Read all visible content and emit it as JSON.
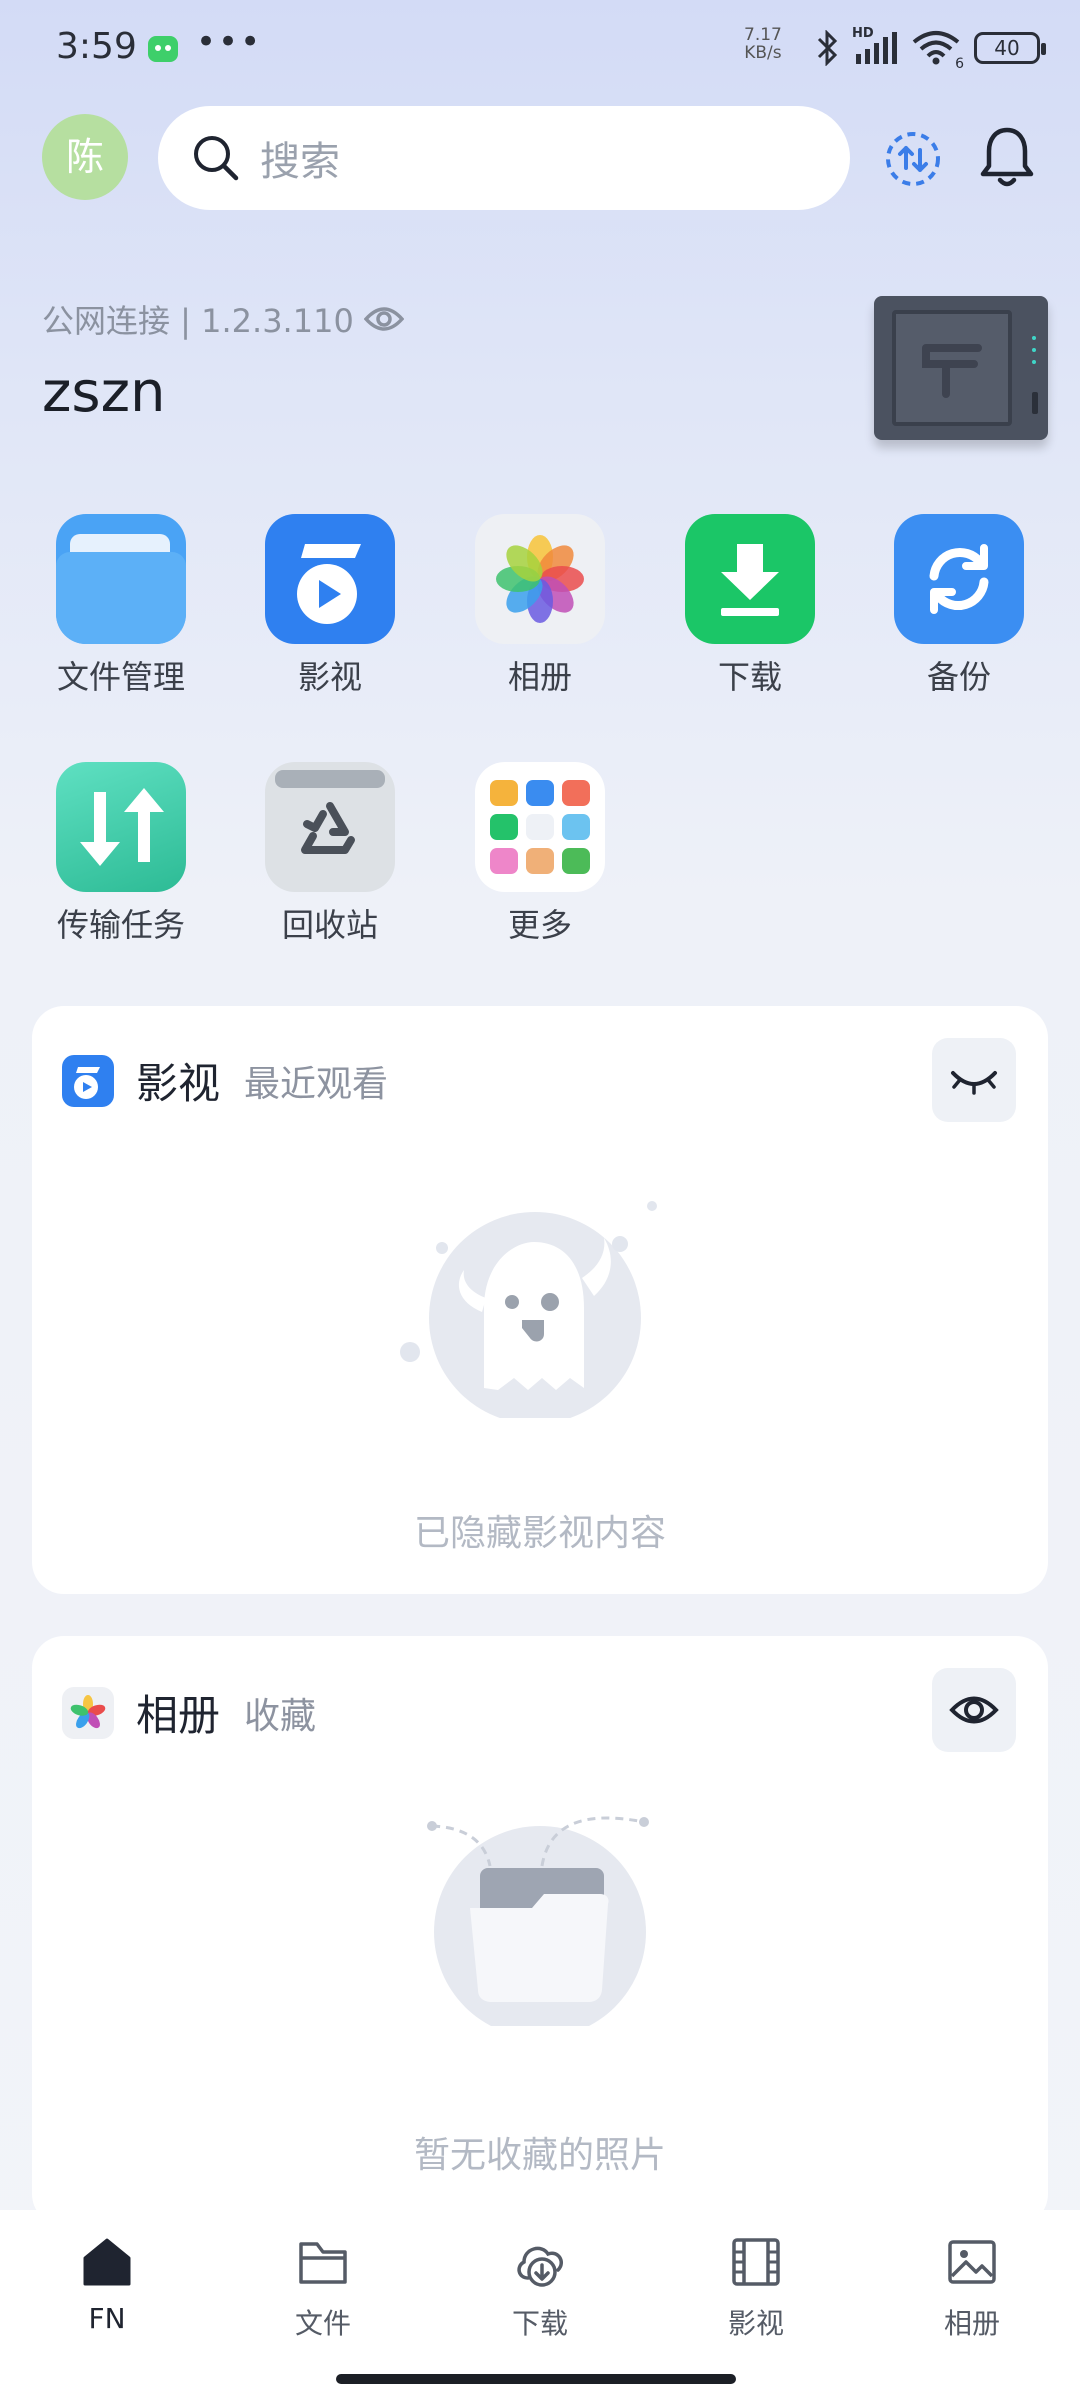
{
  "status_bar": {
    "time": "3:59",
    "dots": "•••",
    "speed_top": "7.17",
    "speed_bottom": "KB/s",
    "network_badge": "HD",
    "wifi_badge": "6",
    "battery": "40"
  },
  "header": {
    "avatar_initial": "陈",
    "search_placeholder": "搜索",
    "icons": [
      "upload-download-icon",
      "bell-icon"
    ]
  },
  "device": {
    "connection": "公网连接 | 1.2.3.110",
    "name": "zszn"
  },
  "apps": [
    {
      "label": "文件管理",
      "icon": "folder-icon",
      "color": "#4aa3f5"
    },
    {
      "label": "影视",
      "icon": "film-icon",
      "color": "#2f80f0"
    },
    {
      "label": "相册",
      "icon": "photos-flower-icon",
      "color": "#eef0f4"
    },
    {
      "label": "下载",
      "icon": "download-icon",
      "color": "#1bc667"
    },
    {
      "label": "备份",
      "icon": "sync-icon",
      "color": "#3b8ef2"
    },
    {
      "label": "传输任务",
      "icon": "transfer-icon",
      "color": "#37cfa8"
    },
    {
      "label": "回收站",
      "icon": "recycle-icon",
      "color": "#d9dde2"
    },
    {
      "label": "更多",
      "icon": "more-grid-icon",
      "color": "#ffffff"
    }
  ],
  "cards": {
    "video": {
      "title": "影视",
      "subtitle": "最近观看",
      "empty": "已隐藏影视内容"
    },
    "album": {
      "title": "相册",
      "subtitle": "收藏",
      "empty": "暂无收藏的照片"
    }
  },
  "bottom_nav": [
    {
      "label": "FN",
      "icon": "home-icon"
    },
    {
      "label": "文件",
      "icon": "folder-outline-icon"
    },
    {
      "label": "下载",
      "icon": "cloud-download-icon"
    },
    {
      "label": "影视",
      "icon": "film-strip-icon"
    },
    {
      "label": "相册",
      "icon": "image-icon"
    }
  ]
}
